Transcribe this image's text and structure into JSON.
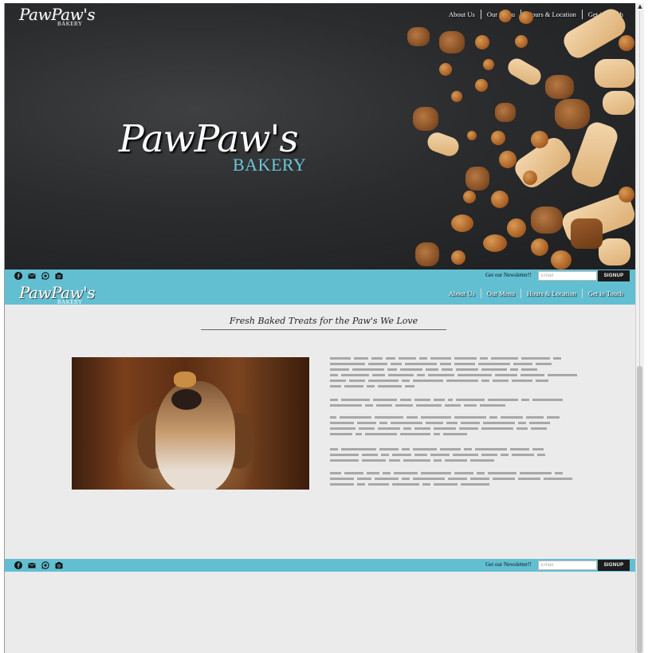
{
  "brand": {
    "name": "PawPaw's",
    "sub": "BAKERY"
  },
  "nav": {
    "items": [
      "About Us",
      "Our Menu",
      "Hours & Location",
      "Get in Touch"
    ]
  },
  "hero": {
    "title": "PawPaw's",
    "subtitle": "BAKERY"
  },
  "social": {
    "icons": [
      "facebook-icon",
      "email-icon",
      "whatsapp-icon",
      "camera-icon"
    ],
    "newsletter_label": "Get our Newsletter!!",
    "email_placeholder": "Email",
    "signup_label": "SIGNUP"
  },
  "content": {
    "tagline": "Fresh Baked Treats for the Paw's We Love"
  },
  "colors": {
    "accent": "#62bfd2",
    "hero_bg": "#2b2c2e",
    "signup_bg": "#1c1c1c",
    "page_bg": "#ebebeb"
  }
}
